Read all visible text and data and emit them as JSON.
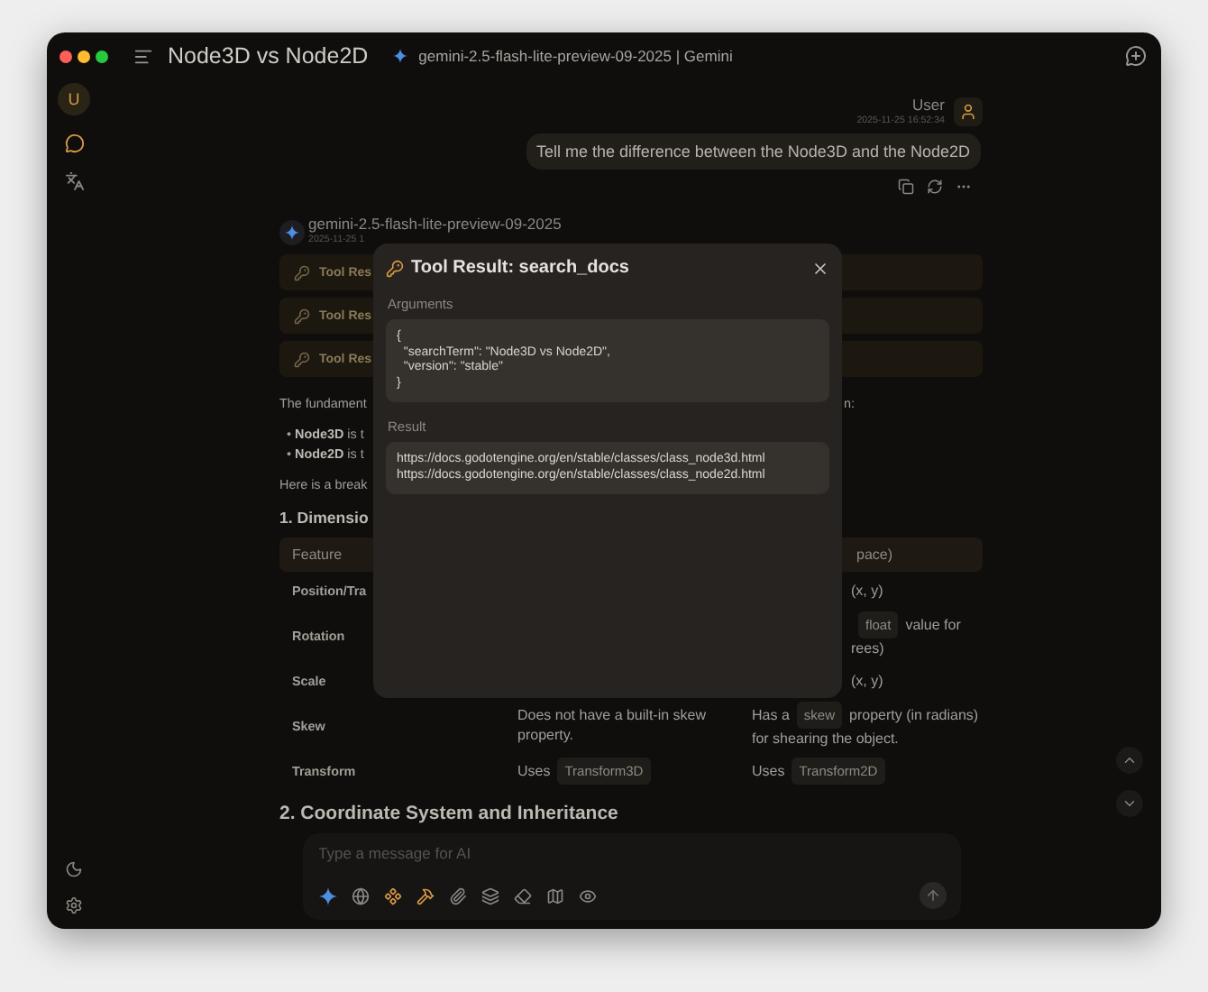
{
  "window": {
    "title": "Node3D vs Node2D",
    "model": "gemini-2.5-flash-lite-preview-09-2025 | Gemini"
  },
  "sidebar": {
    "avatar": "U",
    "items": [
      {
        "kind": "chat",
        "selected": true
      },
      {
        "kind": "translate",
        "selected": false
      }
    ]
  },
  "user_message": {
    "author": "User",
    "time": "2025-11-25 16:52:34",
    "text": "Tell me the difference between the Node3D and the Node2D"
  },
  "assistant": {
    "model": "gemini-2.5-flash-lite-preview-09-2025",
    "time": "2025-11-25 1",
    "tool_calls": [
      "Tool Res",
      "Tool Res",
      "Tool Res"
    ],
    "intro": {
      "start": "The fundament",
      "end": "n:"
    },
    "bullets": [
      "• **Node3D** is t",
      "• **Node2D** is t"
    ],
    "lead": "Here is a break",
    "heading": "1. Dimensio",
    "table": {
      "header": {
        "column_1": "Feature",
        "column_3": "pace)"
      },
      "rows": [
        {
          "column_1": "Position/Tra",
          "column_3": {
            "covered": true,
            "lines": [
              [
                {
                  "kind": "text",
                  "text": "(x, y)"
                }
              ]
            ]
          }
        },
        {
          "column_1": "Rotation",
          "column_3": {
            "covered": true,
            "lines": [
              [
                {
                  "kind": "code",
                  "text": "float"
                },
                {
                  "kind": "text",
                  "text": "value for"
                }
              ],
              [
                {
                  "kind": "text",
                  "text": "rees)"
                }
              ]
            ]
          }
        },
        {
          "column_1": "Scale",
          "column_3": {
            "covered": true,
            "lines": [
              [
                {
                  "kind": "text",
                  "text": "(x, y)"
                }
              ]
            ]
          }
        },
        {
          "column_1": "Skew",
          "column_2": {
            "covered": false,
            "lines": [
              [
                {
                  "kind": "text",
                  "text": "Does not have a built-in skew"
                }
              ],
              [
                {
                  "kind": "text",
                  "text": "property."
                }
              ]
            ]
          },
          "column_3": {
            "covered": false,
            "lines": [
              [
                {
                  "kind": "text",
                  "text": "Has a"
                },
                {
                  "kind": "code",
                  "text": "skew"
                },
                {
                  "kind": "text",
                  "text": "property (in radians)"
                }
              ],
              [
                {
                  "kind": "text",
                  "text": "for shearing the object."
                }
              ]
            ]
          }
        },
        {
          "column_1": "Transform",
          "column_2": {
            "covered": false,
            "lines": [
              [
                {
                  "kind": "text",
                  "text": "Uses"
                },
                {
                  "kind": "code",
                  "text": "Transform3D"
                }
              ]
            ]
          },
          "column_3": {
            "covered": false,
            "lines": [
              [
                {
                  "kind": "text",
                  "text": "Uses"
                },
                {
                  "kind": "code",
                  "text": "Transform2D"
                }
              ]
            ]
          }
        }
      ]
    },
    "heading_2": "2. Coordinate System and Inheritance"
  },
  "composer": {
    "placeholder": "Type a message for AI",
    "tools": [
      {
        "kind": "model"
      },
      {
        "kind": "web",
        "on": false
      },
      {
        "kind": "mcp",
        "on": true
      },
      {
        "kind": "tools",
        "on": true
      },
      {
        "kind": "attach",
        "on": false
      },
      {
        "kind": "knowledge",
        "on": false
      },
      {
        "kind": "clear",
        "on": false
      },
      {
        "kind": "map",
        "on": false
      },
      {
        "kind": "preview",
        "on": false
      }
    ]
  },
  "dialog": {
    "title": "Tool Result: search_docs",
    "sections": [
      {
        "label": "Arguments",
        "code": "{\n  \"searchTerm\": \"Node3D vs Node2D\",\n  \"version\": \"stable\"\n}"
      },
      {
        "label": "Result",
        "code": "https://docs.godotengine.org/en/stable/classes/class_node3d.html\nhttps://docs.godotengine.org/en/stable/classes/class_node2d.html"
      }
    ]
  }
}
